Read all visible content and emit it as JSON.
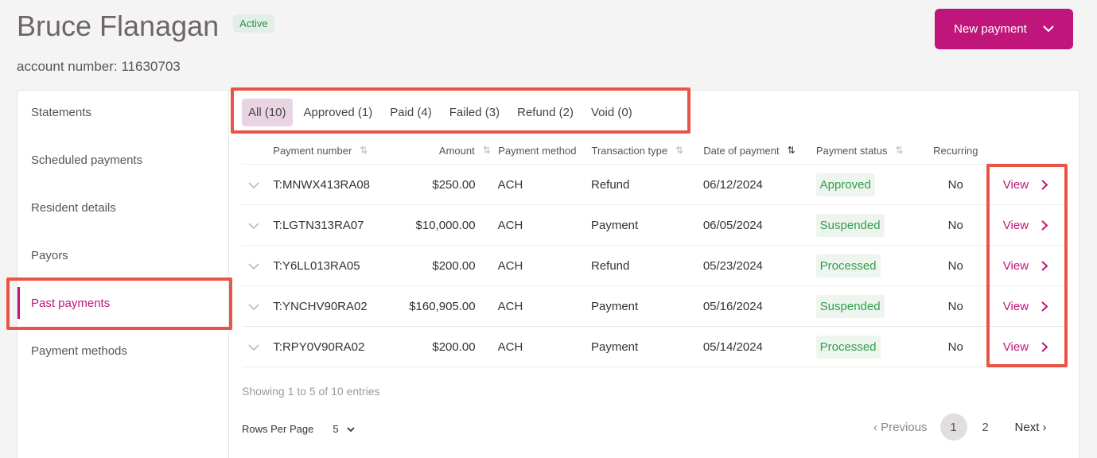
{
  "header": {
    "name": "Bruce Flanagan",
    "status": "Active",
    "account_number": "account number: 11630703",
    "new_payment_label": "New payment"
  },
  "sidebar": {
    "items": [
      {
        "label": "Statements"
      },
      {
        "label": "Scheduled payments"
      },
      {
        "label": "Resident details"
      },
      {
        "label": "Payors"
      },
      {
        "label": "Past payments"
      },
      {
        "label": "Payment methods"
      }
    ]
  },
  "tabs": [
    {
      "label": "All (10)"
    },
    {
      "label": "Approved (1)"
    },
    {
      "label": "Paid (4)"
    },
    {
      "label": "Failed (3)"
    },
    {
      "label": "Refund (2)"
    },
    {
      "label": "Void (0)"
    }
  ],
  "table": {
    "headers": {
      "payment_number": "Payment number",
      "amount": "Amount",
      "payment_method": "Payment method",
      "transaction_type": "Transaction type",
      "date_of_payment": "Date of payment",
      "payment_status": "Payment status",
      "recurring": "Recurring"
    },
    "view_label": "View",
    "rows": [
      {
        "number": "T:MNWX413RA08",
        "amount": "$250.00",
        "method": "ACH",
        "type": "Refund",
        "date": "06/12/2024",
        "status": "Approved",
        "recurring": "No"
      },
      {
        "number": "T:LGTN313RA07",
        "amount": "$10,000.00",
        "method": "ACH",
        "type": "Payment",
        "date": "06/05/2024",
        "status": "Suspended",
        "recurring": "No"
      },
      {
        "number": "T:Y6LL013RA05",
        "amount": "$200.00",
        "method": "ACH",
        "type": "Refund",
        "date": "05/23/2024",
        "status": "Processed",
        "recurring": "No"
      },
      {
        "number": "T:YNCHV90RA02",
        "amount": "$160,905.00",
        "method": "ACH",
        "type": "Payment",
        "date": "05/16/2024",
        "status": "Suspended",
        "recurring": "No"
      },
      {
        "number": "T:RPY0V90RA02",
        "amount": "$200.00",
        "method": "ACH",
        "type": "Payment",
        "date": "05/14/2024",
        "status": "Processed",
        "recurring": "No"
      }
    ]
  },
  "footer": {
    "showing": "Showing 1 to 5 of 10 entries",
    "rows_per_page_label": "Rows Per Page",
    "rows_per_page_value": "5",
    "prev_label": "Previous",
    "page_1": "1",
    "page_2": "2",
    "next_label": "Next"
  },
  "colors": {
    "brand": "#c0157a",
    "status_green": "#2f9e4b",
    "highlight": "#ea5446"
  }
}
